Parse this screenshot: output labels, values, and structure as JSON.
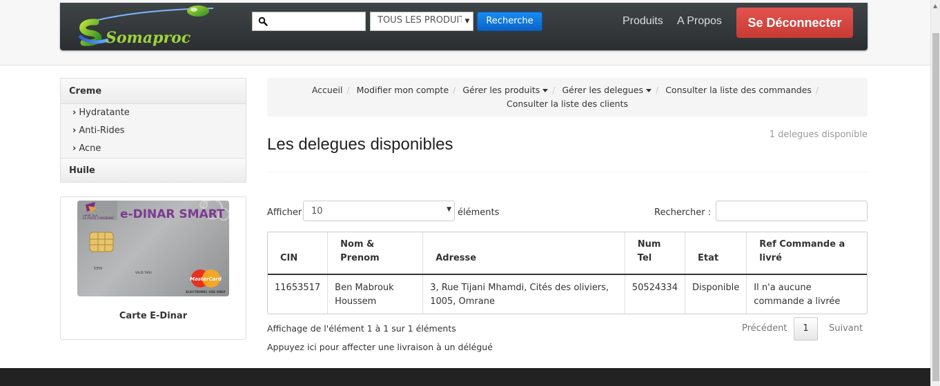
{
  "brand": {
    "logo_text": "Somaproc"
  },
  "header": {
    "search_placeholder": "",
    "category_select": "TOUS LES PRODUITS",
    "search_button": "Recherche",
    "nav_products": "Produits",
    "nav_about": "A Propos",
    "logout_button": "Se Déconnecter"
  },
  "sidebar": {
    "categories": [
      {
        "label": "Creme",
        "items": [
          "Hydratante",
          "Anti-Rides",
          "Acne"
        ]
      },
      {
        "label": "Huile",
        "items": []
      }
    ],
    "card": {
      "brand_text": "e-DINAR SMART",
      "mastercard_text": "MasterCard",
      "electronic_text": "ELECTRONIC USE ONLY",
      "card_number": "5359",
      "valid_thru": "VALID THRU",
      "caption": "Carte E-Dinar"
    }
  },
  "breadcrumb": {
    "items": [
      "Accueil",
      "Modifier mon compte",
      "Gérer les produits",
      "Gérer les delegues",
      "Consulter la liste des commandes",
      "Consulter la liste des clients"
    ]
  },
  "main": {
    "title": "Les delegues disponibles",
    "count_note": "1 delegues disponible",
    "show_label": "Afficher",
    "page_length": "10",
    "elements_label": "éléments",
    "search_label": "Rechercher :",
    "filter_value": ""
  },
  "table": {
    "headers": [
      "CIN",
      "Nom & Prenom",
      "Adresse",
      "Num Tel",
      "Etat",
      "Ref Commande a livré"
    ],
    "rows": [
      [
        "11653517",
        "Ben Mabrouk Houssem",
        "3, Rue Tijani Mhamdi, Cités des oliviers, 1005, Omrane",
        "50524334",
        "Disponible",
        "Il n'a aucune commande a livrée"
      ]
    ]
  },
  "pagination": {
    "info": "Affichage de l'élément 1 à 1 sur 1 éléments",
    "prev": "Précédent",
    "current": "1",
    "next": "Suivant"
  },
  "assign_link": "Appuyez ici pour affecter une livraison à un délégué",
  "colors": {
    "navbar": "#33373a",
    "logout": "#d9453f",
    "search_button": "#0e72dc"
  }
}
